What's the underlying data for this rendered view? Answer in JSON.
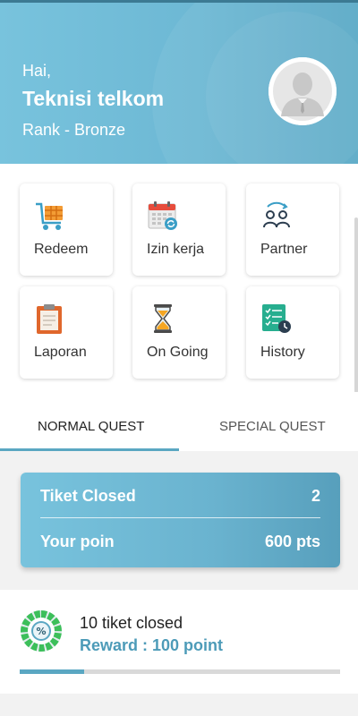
{
  "header": {
    "greeting": "Hai,",
    "name": "Teknisi telkom",
    "rank": "Rank - Bronze"
  },
  "menu": [
    {
      "label": "Redeem",
      "icon": "shopping-cart-icon"
    },
    {
      "label": "Izin kerja",
      "icon": "calendar-icon"
    },
    {
      "label": "Partner",
      "icon": "partner-users-icon"
    },
    {
      "label": "Laporan",
      "icon": "clipboard-icon"
    },
    {
      "label": "On Going",
      "icon": "hourglass-icon"
    },
    {
      "label": "History",
      "icon": "checklist-clock-icon"
    }
  ],
  "tabs": [
    {
      "label": "NORMAL QUEST",
      "active": true
    },
    {
      "label": "SPECIAL QUEST",
      "active": false
    }
  ],
  "stats": {
    "tiket_label": "Tiket Closed",
    "tiket_value": "2",
    "poin_label": "Your poin",
    "poin_value": "600 pts"
  },
  "quest": {
    "title": "10 tiket closed",
    "reward": "Reward : 100 point",
    "progress": 0.2
  },
  "colors": {
    "accent": "#5aa7c2",
    "header": "#6db8d4"
  }
}
